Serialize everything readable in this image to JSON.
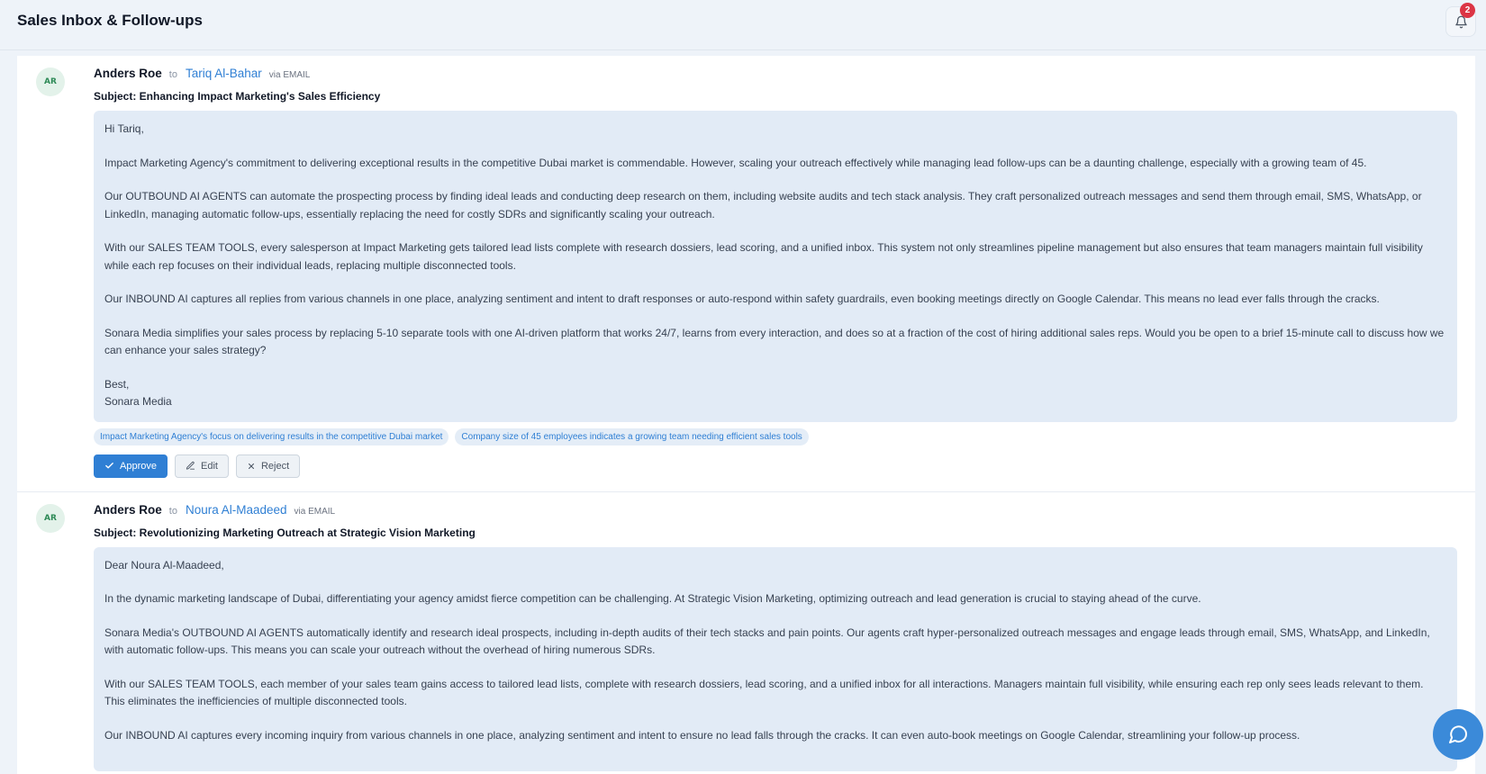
{
  "header": {
    "title": "Sales Inbox & Follow-ups",
    "notification_count": "2",
    "bell_icon": "bell-icon"
  },
  "messages": [
    {
      "avatar": "AR",
      "sender": "Anders Roe",
      "to_label": "to",
      "recipient": "Tariq Al-Bahar",
      "channel": "via EMAIL",
      "subject": "Subject: Enhancing Impact Marketing's Sales Efficiency",
      "body": [
        "Hi Tariq,",
        "Impact Marketing Agency's commitment to delivering exceptional results in the competitive Dubai market is commendable. However, scaling your outreach effectively while managing lead follow-ups can be a daunting challenge, especially with a growing team of 45.",
        "Our OUTBOUND AI AGENTS can automate the prospecting process by finding ideal leads and conducting deep research on them, including website audits and tech stack analysis. They craft personalized outreach messages and send them through email, SMS, WhatsApp, or LinkedIn, managing automatic follow-ups, essentially replacing the need for costly SDRs and significantly scaling your outreach.",
        "With our SALES TEAM TOOLS, every salesperson at Impact Marketing gets tailored lead lists complete with research dossiers, lead scoring, and a unified inbox. This system not only streamlines pipeline management but also ensures that team managers maintain full visibility while each rep focuses on their individual leads, replacing multiple disconnected tools.",
        "Our INBOUND AI captures all replies from various channels in one place, analyzing sentiment and intent to draft responses or auto-respond within safety guardrails, even booking meetings directly on Google Calendar. This means no lead ever falls through the cracks.",
        "Sonara Media simplifies your sales process by replacing 5-10 separate tools with one AI-driven platform that works 24/7, learns from every interaction, and does so at a fraction of the cost of hiring additional sales reps. Would you be open to a brief 15-minute call to discuss how we can enhance your sales strategy?"
      ],
      "signoff": [
        "Best,",
        "Sonara Media"
      ],
      "tags": [
        "Impact Marketing Agency's focus on delivering results in the competitive Dubai market",
        "Company size of 45 employees indicates a growing team needing efficient sales tools"
      ],
      "actions": {
        "approve": "Approve",
        "edit": "Edit",
        "reject": "Reject"
      }
    },
    {
      "avatar": "AR",
      "sender": "Anders Roe",
      "to_label": "to",
      "recipient": "Noura Al-Maadeed",
      "channel": "via EMAIL",
      "subject": "Subject: Revolutionizing Marketing Outreach at Strategic Vision Marketing",
      "body": [
        "Dear Noura Al-Maadeed,",
        "In the dynamic marketing landscape of Dubai, differentiating your agency amidst fierce competition can be challenging. At Strategic Vision Marketing, optimizing outreach and lead generation is crucial to staying ahead of the curve.",
        "Sonara Media's OUTBOUND AI AGENTS automatically identify and research ideal prospects, including in-depth audits of their tech stacks and pain points. Our agents craft hyper-personalized outreach messages and engage leads through email, SMS, WhatsApp, and LinkedIn, with automatic follow-ups. This means you can scale your outreach without the overhead of hiring numerous SDRs.",
        "With our SALES TEAM TOOLS, each member of your sales team gains access to tailored lead lists, complete with research dossiers, lead scoring, and a unified inbox for all interactions. Managers maintain full visibility, while ensuring each rep only sees leads relevant to them. This eliminates the inefficiencies of multiple disconnected tools.",
        "Our INBOUND AI captures every incoming inquiry from various channels in one place, analyzing sentiment and intent to ensure no lead falls through the cracks. It can even auto-book meetings on Google Calendar, streamlining your follow-up process."
      ]
    }
  ],
  "chat_fab": {
    "icon": "chat-bubble-icon"
  },
  "colors": {
    "accent": "#2f7fd4",
    "badge": "#dc3545",
    "body_bg": "#e2ebf6",
    "avatar_text": "#2e8a57"
  }
}
